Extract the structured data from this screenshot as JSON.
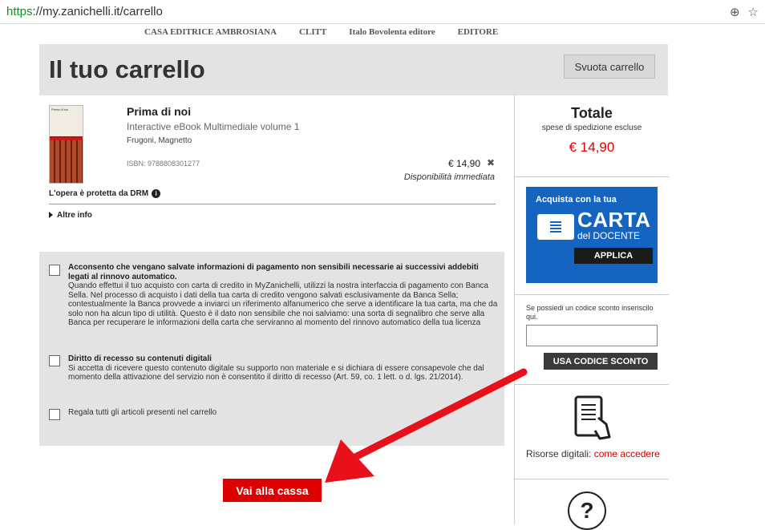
{
  "browser": {
    "url_scheme": "https",
    "url_rest": "://my.zanichelli.it/carrello"
  },
  "logos": [
    "CASA EDITRICE AMBROSIANA",
    "CLITT",
    "Italo Bovolenta editore",
    "EDITORE"
  ],
  "header": {
    "title": "Il tuo carrello",
    "empty_label": "Svuota carrello"
  },
  "item": {
    "title": "Prima di noi",
    "subtitle": "Interactive eBook Multimediale volume 1",
    "authors": "Frugoni, Magnetto",
    "isbn": "ISBN: 9788808301277",
    "price": "€ 14,90",
    "availability": "Disponibilità immediata",
    "drm": "L'opera è protetta da DRM",
    "more": "Altre info",
    "cover_title": "Prima di noi"
  },
  "consents": [
    {
      "title": "Acconsento che vengano salvate informazioni di pagamento non sensibili necessarie ai successivi addebiti legati al rinnovo automatico.",
      "body": "Quando effettui il tuo acquisto con carta di credito in MyZanichelli, utilizzi la nostra interfaccia di pagamento con Banca Sella. Nel processo di acquisto i dati della tua carta di credito vengono salvati esclusivamente da Banca Sella; contestualmente la Banca provvede a inviarci un riferimento alfanumerico che serve a identificare la tua carta, ma che da solo non ha alcun tipo di utilità. Questo è il dato non sensibile che noi salviamo: una sorta di segnalibro che serve alla Banca per recuperare le informazioni della carta che serviranno al momento del rinnovo automatico della tua licenza"
    },
    {
      "title": "Diritto di recesso su contenuti digitali",
      "body": "Si accetta di ricevere questo contenuto digitale su supporto non materiale e si dichiara di essere consapevole che dal momento della attivazione del servizio non è consentito il diritto di recesso (Art. 59, co. 1 lett. o d. lgs. 21/2014)."
    },
    {
      "title": "",
      "body": "Regala tutti gli articoli presenti nel carrello"
    }
  ],
  "sidebar": {
    "total_label": "Totale",
    "total_note": "spese di spedizione escluse",
    "total_amount": "€ 14,90",
    "carta_lead": "Acquista con la tua",
    "carta_big": "CARTA",
    "carta_small": "del DOCENTE",
    "carta_apply": "APPLICA",
    "discount_note": "Se possiedi un codice sconto inseriscilo qui.",
    "discount_value": "",
    "discount_button": "USA CODICE SCONTO",
    "resources_label": "Risorse digitali:",
    "resources_link": "come accedere",
    "help_glyph": "?"
  },
  "checkout_label": "Vai alla cassa",
  "colors": {
    "accent_red": "#dd0000",
    "carta_blue": "#1565c0",
    "panel_gray": "#e3e3e3"
  }
}
